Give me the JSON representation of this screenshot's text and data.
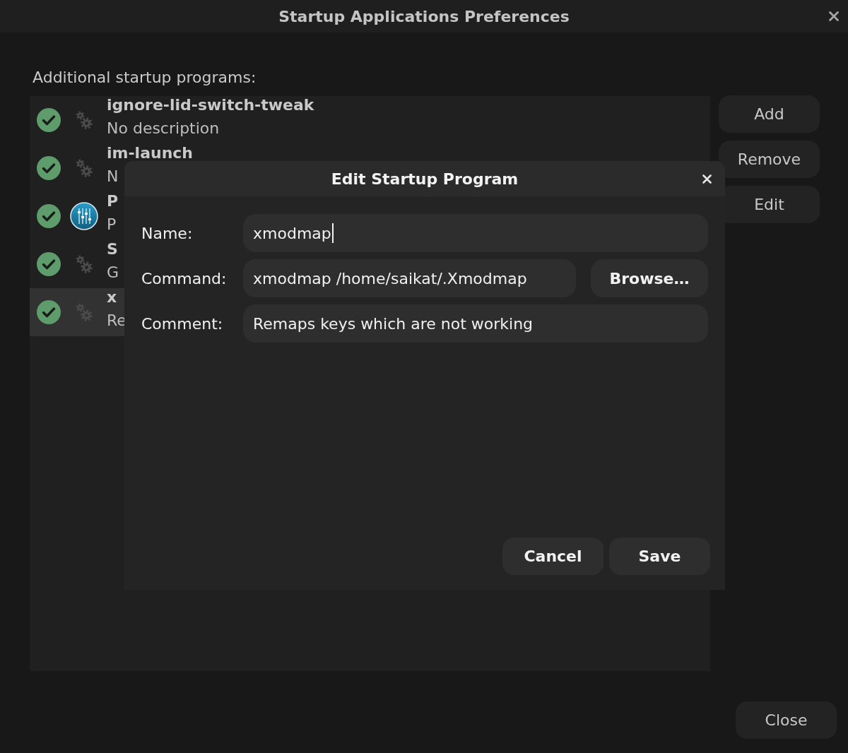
{
  "window": {
    "title": "Startup Applications Preferences"
  },
  "programs_label": "Additional startup programs:",
  "programs": [
    {
      "name": "ignore-lid-switch-tweak",
      "description": "No description",
      "enabled": true,
      "kind": "gear",
      "selected": false
    },
    {
      "name": "im-launch",
      "description": "N",
      "enabled": true,
      "kind": "gear",
      "selected": false
    },
    {
      "name": "P",
      "description": "P",
      "enabled": true,
      "kind": "mixer",
      "selected": false
    },
    {
      "name": "S",
      "description": "G",
      "enabled": true,
      "kind": "gear",
      "selected": false
    },
    {
      "name": "x",
      "description": "Re",
      "enabled": true,
      "kind": "gear",
      "selected": true
    }
  ],
  "side_buttons": [
    "Add",
    "Remove",
    "Edit"
  ],
  "close_button": "Close",
  "dialog": {
    "title": "Edit Startup Program",
    "fields": [
      {
        "label": "Name:",
        "value": "xmodmap",
        "focused": true
      },
      {
        "label": "Command:",
        "value": "xmodmap /home/saikat/.Xmodmap",
        "focused": false,
        "button": "Browse…"
      },
      {
        "label": "Comment:",
        "value": "Remaps keys which are not working",
        "focused": false
      }
    ],
    "buttons": [
      "Cancel",
      "Save"
    ]
  }
}
